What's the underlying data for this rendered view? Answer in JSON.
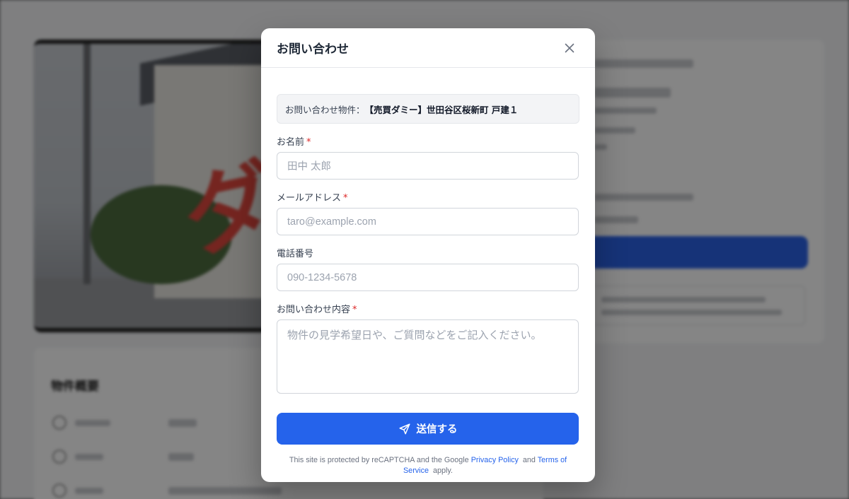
{
  "background": {
    "section_title": "物件概要",
    "brand_color": "#2b63e6"
  },
  "modal": {
    "title": "お問い合わせ",
    "property_prefix": "お問い合わせ物件：",
    "property_name": "【売買ダミー】世田谷区桜新町 戸建１",
    "required_mark": "*",
    "fields": {
      "name": {
        "label": "お名前",
        "placeholder": "田中 太郎"
      },
      "email": {
        "label": "メールアドレス",
        "placeholder": "taro@example.com"
      },
      "phone": {
        "label": "電話番号",
        "placeholder": "090-1234-5678"
      },
      "message": {
        "label": "お問い合わせ内容",
        "placeholder": "物件の見学希望日や、ご質問などをご記入ください。"
      }
    },
    "submit_label": "送信する",
    "recaptcha": {
      "text1": "This site is protected by reCAPTCHA and the Google",
      "privacy": "Privacy Policy",
      "and": "and",
      "terms": "Terms of Service",
      "apply": "apply."
    },
    "accent_color": "#2563eb"
  }
}
